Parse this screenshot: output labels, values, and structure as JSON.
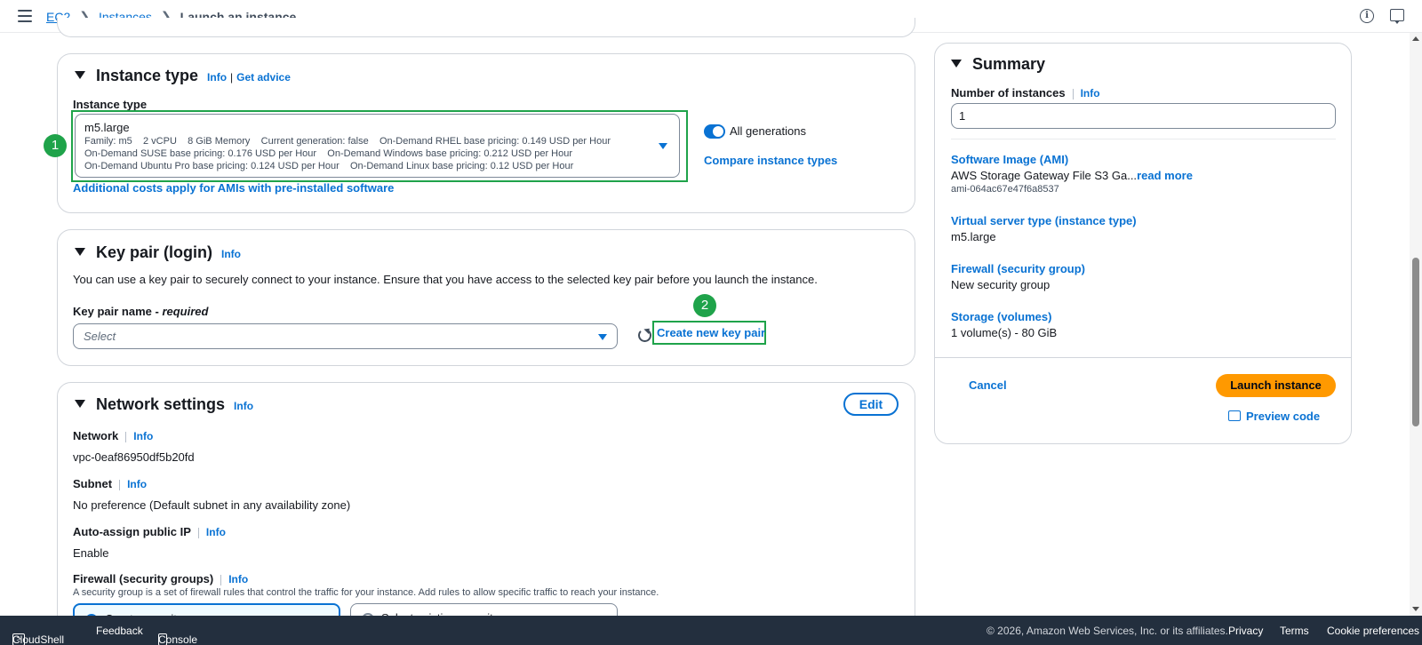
{
  "breadcrumb": {
    "ec2": "EC2",
    "instances": "Instances",
    "current": "Launch an instance"
  },
  "instance_type": {
    "title": "Instance type",
    "info": "Info",
    "get_advice": "Get advice",
    "field_label": "Instance type",
    "selected": "m5.large",
    "detail_line1": "Family: m5    2 vCPU    8 GiB Memory    Current generation: false    On-Demand RHEL base pricing: 0.149 USD per Hour",
    "detail_line2": "On-Demand SUSE base pricing: 0.176 USD per Hour    On-Demand Windows base pricing: 0.212 USD per Hour",
    "detail_line3": "On-Demand Ubuntu Pro base pricing: 0.124 USD per Hour    On-Demand Linux base pricing: 0.12 USD per Hour",
    "all_generations": "All generations",
    "compare": "Compare instance types",
    "additional_costs": "Additional costs apply for AMIs with pre-installed software",
    "badge": "1"
  },
  "key_pair": {
    "title": "Key pair (login)",
    "info": "Info",
    "description": "You can use a key pair to securely connect to your instance. Ensure that you have access to the selected key pair before you launch the instance.",
    "name_label": "Key pair name - ",
    "required": "required",
    "placeholder": "Select",
    "create": "Create new key pair",
    "badge": "2"
  },
  "network": {
    "title": "Network settings",
    "info": "Info",
    "edit": "Edit",
    "network_label": "Network",
    "network_value": "vpc-0eaf86950df5b20fd",
    "subnet_label": "Subnet",
    "subnet_value": "No preference (Default subnet in any availability zone)",
    "public_ip_label": "Auto-assign public IP",
    "public_ip_value": "Enable",
    "firewall_label": "Firewall (security groups)",
    "firewall_desc": "A security group is a set of firewall rules that control the traffic for your instance. Add rules to allow specific traffic to reach your instance.",
    "option_create": "Create security group",
    "option_select": "Select existing security group"
  },
  "summary": {
    "title": "Summary",
    "num_instances_label": "Number of instances",
    "info": "Info",
    "num_instances_value": "1",
    "ami_label": "Software Image (AMI)",
    "ami_value": "AWS Storage Gateway File S3 Ga...",
    "read_more": "read more",
    "ami_id": "ami-064ac67e47f6a8537",
    "server_type_label": "Virtual server type (instance type)",
    "server_type_value": "m5.large",
    "firewall_label": "Firewall (security group)",
    "firewall_value": "New security group",
    "storage_label": "Storage (volumes)",
    "storage_value": "1 volume(s) - 80 GiB",
    "cancel": "Cancel",
    "launch": "Launch instance",
    "preview": "Preview code"
  },
  "footer": {
    "cloudshell": "CloudShell",
    "feedback": "Feedback",
    "mobile_app": "Console Mobile App",
    "copyright": "© 2026, Amazon Web Services, Inc. or its affiliates.",
    "privacy": "Privacy",
    "terms": "Terms",
    "cookies": "Cookie preferences"
  },
  "colors": {
    "accent": "#0972d3",
    "highlight": "#1fa34a",
    "primary_button": "#ff9900",
    "footer_bg": "#232f3e"
  }
}
